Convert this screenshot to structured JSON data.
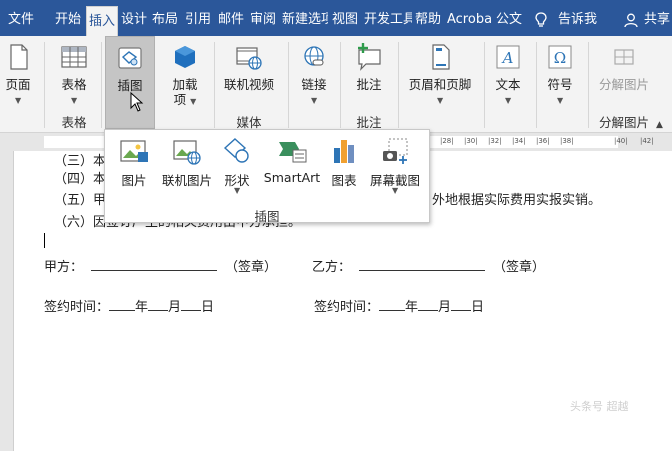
{
  "tabs": [
    {
      "label": "文件",
      "active": false
    },
    {
      "label": "开始",
      "active": false
    },
    {
      "label": "插入",
      "active": true
    },
    {
      "label": "设计",
      "active": false
    },
    {
      "label": "布局",
      "active": false
    },
    {
      "label": "引用",
      "active": false
    },
    {
      "label": "邮件",
      "active": false
    },
    {
      "label": "审阅",
      "active": false
    },
    {
      "label": "新建选项",
      "active": false
    },
    {
      "label": "视图",
      "active": false
    },
    {
      "label": "开发工具",
      "active": false
    },
    {
      "label": "帮助",
      "active": false
    },
    {
      "label": "Acroba",
      "active": false
    },
    {
      "label": "公文",
      "active": false
    }
  ],
  "tell_me": "告诉我",
  "share": "共享",
  "ribbon": {
    "pages": {
      "label": "页面",
      "icon": "page-icon"
    },
    "table": {
      "label": "表格",
      "icon": "table-icon",
      "group": "表格"
    },
    "illustrations": {
      "label": "插图",
      "icon": "illustration-icon"
    },
    "addins": {
      "label1": "加载",
      "label2": "项",
      "icon": "addin-icon"
    },
    "online_video": {
      "label": "联机视频",
      "icon": "video-icon",
      "group": "媒体"
    },
    "links": {
      "label": "链接",
      "icon": "link-icon"
    },
    "comment": {
      "label": "批注",
      "icon": "comment-icon",
      "group": "批注"
    },
    "header_footer": {
      "label": "页眉和页脚",
      "icon": "header-footer-icon"
    },
    "text": {
      "label": "文本",
      "icon": "text-icon"
    },
    "symbols": {
      "label": "符号",
      "icon": "omega-icon"
    },
    "split_image": {
      "label": "分解图片",
      "icon": "split-image-icon",
      "group": "分解图片"
    }
  },
  "dropdown": {
    "group": "插图",
    "items": [
      {
        "label": "图片",
        "icon": "picture-icon"
      },
      {
        "label": "联机图片",
        "icon": "online-picture-icon"
      },
      {
        "label": "形状",
        "icon": "shapes-icon"
      },
      {
        "label": "SmartArt",
        "icon": "smartart-icon"
      },
      {
        "label": "图表",
        "icon": "chart-icon"
      },
      {
        "label": "屏幕截图",
        "icon": "screenshot-icon"
      }
    ]
  },
  "ruler": {
    "left": "|28|",
    "left2": "|30|",
    "left3": "|32|",
    "mid": "|34|",
    "mid2": "|36|",
    "mid3": "|38|",
    "r1": "|40|",
    "r2": "|42|"
  },
  "document": {
    "line1": "（三）本",
    "line2": "（四）本",
    "line3a": "（五）甲方",
    "line3b": "外地根据实际费用实报实销。",
    "line4": "（六）因签订产生的相关费用由甲方承担。",
    "party_a": "甲方：",
    "sign_a": "（签章）",
    "party_b": "乙方：",
    "sign_b": "（签章）",
    "date_label_a": "签约时间：",
    "date_label_b": "签约时间：",
    "year": "年",
    "month": "月",
    "day": "日"
  },
  "watermark": "头条号 超越"
}
